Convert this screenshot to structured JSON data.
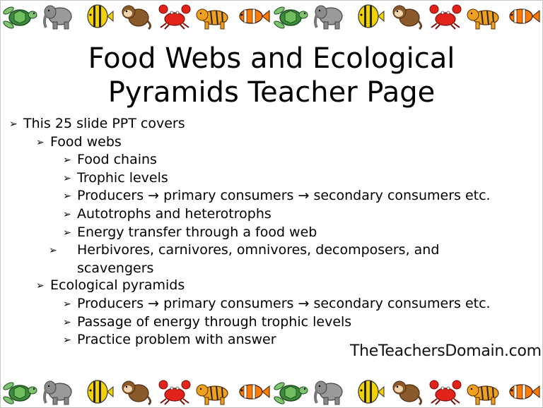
{
  "title_line1": "Food Webs and Ecological",
  "title_line2": "Pyramids Teacher Page",
  "bullet_glyph": "➢",
  "bullets": {
    "b1": "This 25 slide PPT covers",
    "b2": "Food webs",
    "b3": "Food chains",
    "b4": "Trophic levels",
    "b5": "Producers → primary consumers → secondary consumers etc.",
    "b6": "Autotrophs and heterotrophs",
    "b7": "Energy transfer through a food web",
    "b8": "Herbivores, carnivores, omnivores, decomposers, and scavengers",
    "b9": "Ecological pyramids",
    "b10": "Producers → primary consumers → secondary consumers etc.",
    "b11": "Passage of energy through trophic levels",
    "b12": "Practice problem with answer"
  },
  "watermark": "TheTeachersDomain.com",
  "border_animals": [
    "turtle",
    "elephant",
    "butterflyfish",
    "monkey",
    "crab",
    "tiger",
    "clownfish",
    "turtle",
    "elephant",
    "butterflyfish",
    "monkey",
    "crab",
    "tiger",
    "clownfish"
  ]
}
